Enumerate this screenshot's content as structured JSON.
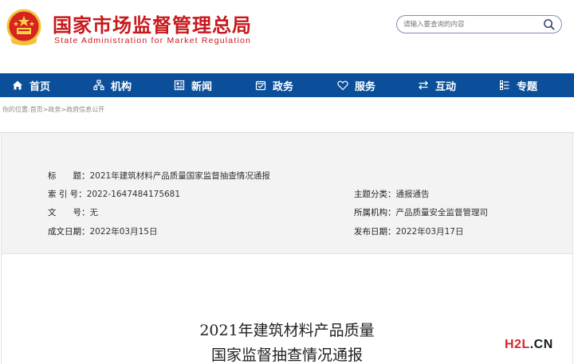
{
  "header": {
    "brand_cn": "国家市场监督管理总局",
    "brand_en": "State Administration for Market Regulation",
    "search": {
      "placeholder": "请输入要查询的内容"
    }
  },
  "nav": {
    "items": [
      {
        "label": "首页",
        "icon": "home-icon"
      },
      {
        "label": "机构",
        "icon": "org-icon"
      },
      {
        "label": "新闻",
        "icon": "news-icon"
      },
      {
        "label": "政务",
        "icon": "gov-icon"
      },
      {
        "label": "服务",
        "icon": "heart-icon"
      },
      {
        "label": "互动",
        "icon": "exchange-icon"
      },
      {
        "label": "专题",
        "icon": "list-icon"
      }
    ]
  },
  "breadcrumb": "你的位置:首页>政务>政府信息公开",
  "info": {
    "title_label": "标　　题：",
    "title_value": "2021年建筑材料产品质量国家监督抽查情况通报",
    "index_label": "索 引 号：",
    "index_value": "2022-1647484175681",
    "doc_no_label": "文　　号：",
    "doc_no_value": "无",
    "created_label": "成文日期：",
    "created_value": "2022年03月15日",
    "topic_label": "主题分类：",
    "topic_value": "通报通告",
    "org_label": "所属机构：",
    "org_value": "产品质量安全监督管理司",
    "published_label": "发布日期：",
    "published_value": "2022年03月17日"
  },
  "document": {
    "title_line1": "2021年建筑材料产品质量",
    "title_line2": "国家监督抽查情况通报"
  },
  "watermark": {
    "part1": "H2L",
    "part2": ".CN"
  },
  "colors": {
    "brand_red": "#c8181b",
    "nav_blue": "#0b4f9a",
    "panel_bg": "#f3f3f3"
  }
}
